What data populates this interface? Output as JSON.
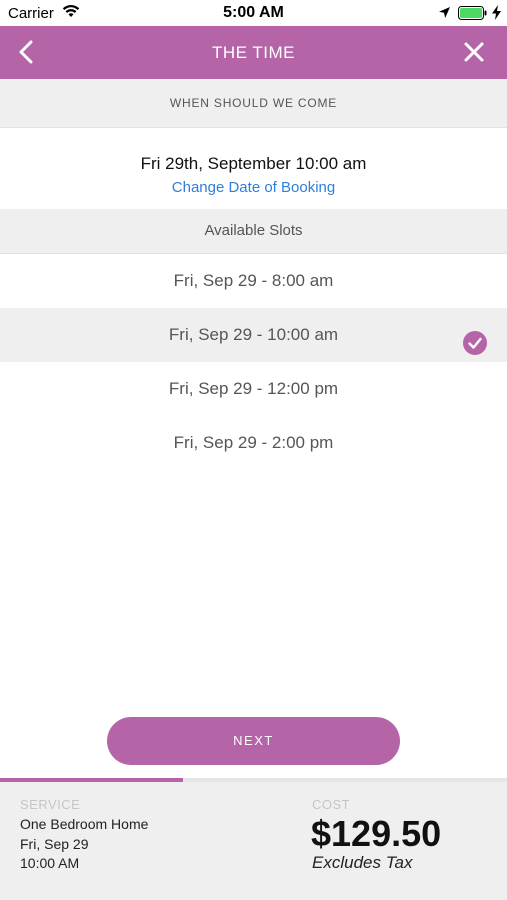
{
  "status_bar": {
    "carrier": "Carrier",
    "time": "5:00 AM",
    "icons": [
      "wifi-icon",
      "location-arrow-icon",
      "battery-icon",
      "charging-bolt-icon"
    ],
    "battery_color": "#4cd964"
  },
  "nav": {
    "title": "THE TIME",
    "back_icon": "chevron-left-icon",
    "close_icon": "close-icon",
    "background": "#b565a7"
  },
  "section_header": "WHEN SHOULD WE COME",
  "booking": {
    "date": "Fri 29th, September 10:00 am",
    "change_link": "Change Date of Booking",
    "link_color": "#2f7fd8"
  },
  "slots": {
    "header": "Available Slots",
    "items": [
      {
        "label": "Fri, Sep 29 - 8:00 am",
        "selected": false
      },
      {
        "label": "Fri, Sep 29 - 10:00 am",
        "selected": true
      },
      {
        "label": "Fri, Sep 29 - 12:00 pm",
        "selected": false
      },
      {
        "label": "Fri, Sep 29 - 2:00 pm",
        "selected": false
      }
    ],
    "selected_icon": "checkmark-circle-icon"
  },
  "next_button": "NEXT",
  "progress": 0.36,
  "footer": {
    "service_label": "SERVICE",
    "service_lines": [
      "One Bedroom Home",
      "Fri, Sep 29",
      "10:00 AM"
    ],
    "cost_label": "COST",
    "cost_value": "$129.50",
    "cost_note": "Excludes Tax"
  }
}
